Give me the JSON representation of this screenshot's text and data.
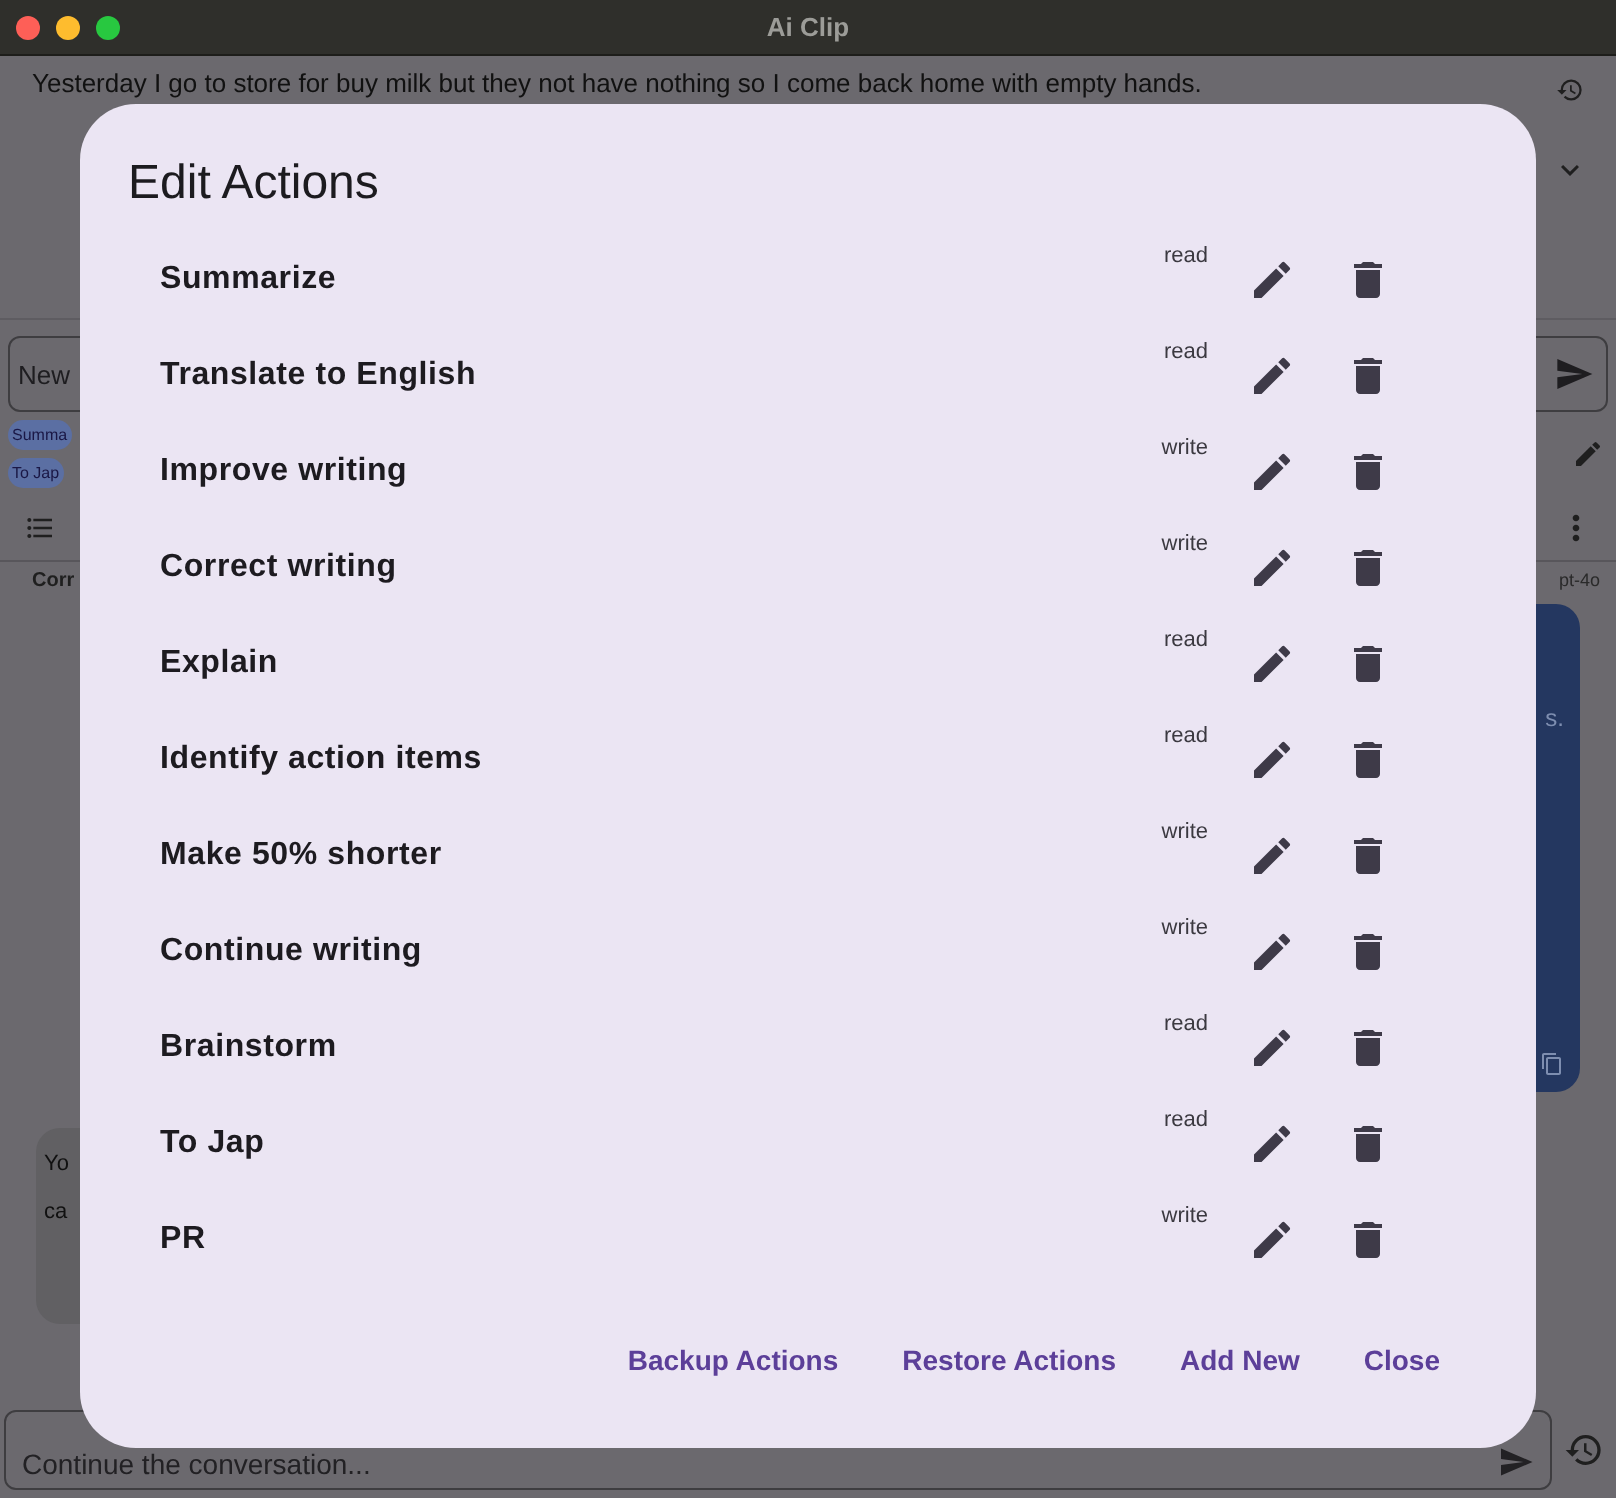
{
  "window": {
    "title": "Ai Clip"
  },
  "background": {
    "prompt_text": "Yesterday I go to store for buy milk but they not have nothing so I come back home with empty hands.",
    "new_field": "New",
    "chips": [
      {
        "label": "Summa"
      },
      {
        "label": "To Jap"
      }
    ],
    "conversation_label": "Corr",
    "model_label": "pt-4o",
    "reply_fragment": "s.",
    "user_bubble_lines": [
      "Yo",
      "ca"
    ],
    "continue_placeholder": "Continue the conversation..."
  },
  "dialog": {
    "title": "Edit Actions",
    "actions": [
      {
        "name": "Summarize",
        "mode": "read"
      },
      {
        "name": "Translate to English",
        "mode": "read"
      },
      {
        "name": "Improve writing",
        "mode": "write"
      },
      {
        "name": "Correct writing",
        "mode": "write"
      },
      {
        "name": "Explain",
        "mode": "read"
      },
      {
        "name": "Identify action items",
        "mode": "read"
      },
      {
        "name": "Make 50% shorter",
        "mode": "write"
      },
      {
        "name": "Continue writing",
        "mode": "write"
      },
      {
        "name": "Brainstorm",
        "mode": "read"
      },
      {
        "name": "To Jap",
        "mode": "read"
      },
      {
        "name": "PR",
        "mode": "write"
      }
    ],
    "buttons": [
      "Backup Actions",
      "Restore Actions",
      "Add New",
      "Close"
    ]
  }
}
